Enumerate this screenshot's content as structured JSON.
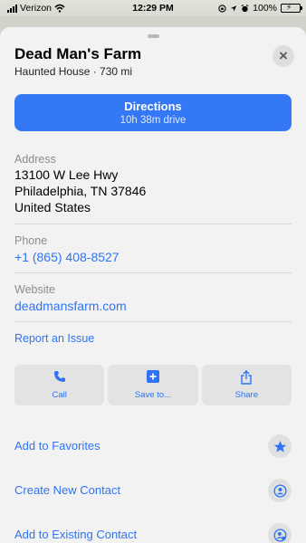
{
  "status_bar": {
    "carrier": "Verizon",
    "time": "12:29 PM",
    "battery": "100%",
    "icons": [
      "signal-icon",
      "wifi-icon",
      "screen-lock-icon",
      "location-icon",
      "alarm-icon",
      "battery-icon"
    ]
  },
  "place": {
    "name": "Dead Man's Farm",
    "subtitle": "Haunted House · 730 mi"
  },
  "directions": {
    "label": "Directions",
    "sublabel": "10h 38m drive"
  },
  "address": {
    "label": "Address",
    "line1": "13100 W Lee Hwy",
    "line2": "Philadelphia, TN 37846",
    "line3": "United States"
  },
  "phone": {
    "label": "Phone",
    "value": "+1 (865) 408-8527"
  },
  "website": {
    "label": "Website",
    "value": "deadmansfarm.com"
  },
  "report_issue": "Report an Issue",
  "actions": [
    {
      "label": "Call",
      "icon": "phone-icon"
    },
    {
      "label": "Save to...",
      "icon": "plus-icon"
    },
    {
      "label": "Share",
      "icon": "share-icon"
    }
  ],
  "list": [
    {
      "label": "Add to Favorites",
      "icon": "star-icon"
    },
    {
      "label": "Create New Contact",
      "icon": "contact-icon"
    },
    {
      "label": "Add to Existing Contact",
      "icon": "add-contact-icon"
    }
  ],
  "colors": {
    "accent": "#3478f6",
    "link": "#2f74f4",
    "sheet_bg": "#f2f2f2",
    "battery": "#34c759"
  }
}
